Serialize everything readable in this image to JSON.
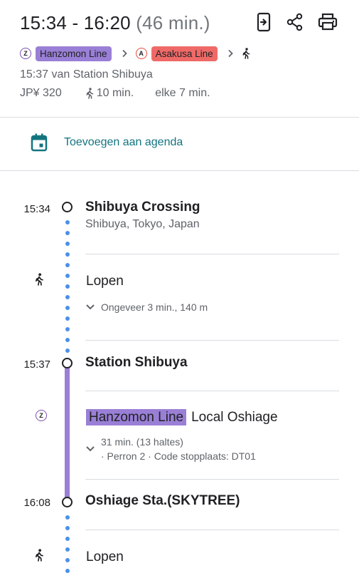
{
  "header": {
    "time_range": "15:34 - 16:20",
    "duration": "(46 min.)",
    "icons": [
      "send-to-phone-icon",
      "share-icon",
      "print-icon"
    ]
  },
  "route": {
    "line1_badge": "Z",
    "line1_name": "Hanzomon Line",
    "line2_badge": "A",
    "line2_name": "Asakusa Line",
    "separator": "›"
  },
  "departure_text": "15:37 van Station Shibuya",
  "fare": "JP¥ 320",
  "walk_total": "10 min.",
  "frequency": "elke 7 min.",
  "add_to_calendar": "Toevoegen aan agenda",
  "timeline": {
    "start_time": "15:34",
    "start_name": "Shibuya Crossing",
    "start_address": "Shibuya, Tokyo, Japan",
    "walk1_label": "Lopen",
    "walk1_detail": "Ongeveer 3 min., 140 m",
    "station_time": "15:37",
    "station_name": "Station Shibuya",
    "transit_badge": "Z",
    "transit_line": "Hanzomon Line",
    "transit_direction": "Local Oshiage",
    "transit_detail_1": "31 min. (13 haltes)",
    "transit_detail_2": "· Perron 2 · Code stopplaats: DT01",
    "arrival_time": "16:08",
    "arrival_name": "Oshiage Sta.(SKYTREE)",
    "walk2_label": "Lopen"
  },
  "colors": {
    "hanzomon": "#9a7fd6",
    "asakusa": "#ef6a67",
    "walk_dots": "#4a90e8",
    "calendar_teal": "#13747f"
  }
}
